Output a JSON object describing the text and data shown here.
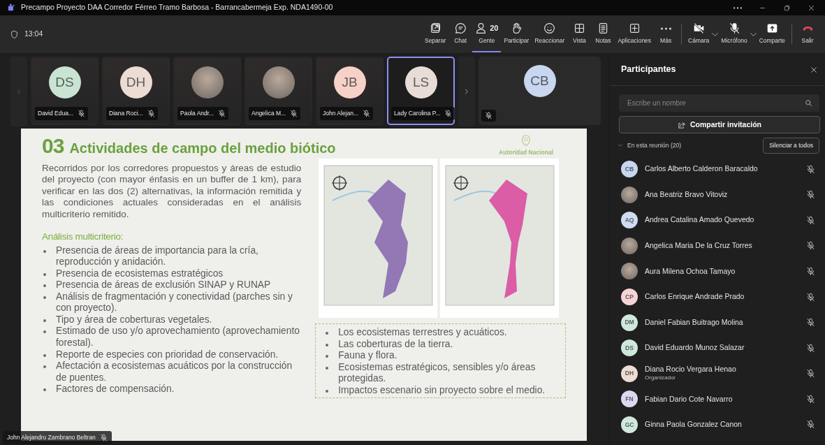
{
  "window": {
    "title": "Precampo Proyecto DAA Corredor Férreo Tramo Barbosa - Barrancabermeja Exp. NDA1490-00"
  },
  "meeting_bar": {
    "timer": "13:04",
    "buttons": [
      {
        "label": "Separar",
        "selected": false
      },
      {
        "label": "Chat",
        "selected": false
      },
      {
        "label": "Gente",
        "count": "20",
        "selected": true
      },
      {
        "label": "Participar",
        "selected": false
      },
      {
        "label": "Reaccionar",
        "selected": false
      },
      {
        "label": "Vista",
        "selected": false
      },
      {
        "label": "Notas",
        "selected": false
      },
      {
        "label": "Aplicaciones",
        "selected": false
      },
      {
        "label": "Más",
        "selected": false
      },
      {
        "label": "Cámara",
        "selected": false,
        "has_menu": true
      },
      {
        "label": "Micrófono",
        "selected": false,
        "has_menu": true
      },
      {
        "label": "Comparte",
        "selected": false
      },
      {
        "label": "Salir",
        "selected": false
      }
    ]
  },
  "video_strip": {
    "tiles": [
      {
        "kind": "initials",
        "initials": "DS",
        "color": "#c9e4d2",
        "name": "David Edua...",
        "selected": false
      },
      {
        "kind": "initials",
        "initials": "DH",
        "color": "#ecdcd4",
        "name": "Diana Roci...",
        "selected": false
      },
      {
        "kind": "photo",
        "name": "Paola Andr...",
        "selected": false
      },
      {
        "kind": "photo",
        "name": "Angelica M...",
        "selected": false
      },
      {
        "kind": "initials",
        "initials": "JB",
        "color": "#f6d1c8",
        "name": "John Alejan...",
        "selected": false
      },
      {
        "kind": "initials",
        "initials": "LS",
        "color": "#e8dcd6",
        "name": "Lady Carolina P...",
        "selected": true
      }
    ],
    "featured": {
      "initials": "CB",
      "color": "#c8d6ef"
    }
  },
  "slide": {
    "number": "03",
    "heading": "Actividades de campo del medio biótico",
    "logo_text": "Autoridad Nacional",
    "intro": "Recorridos por los corredores propuestos y áreas de estudio del proyecto (con mayor énfasis en un buffer de 1 km), para verificar en las dos (2) alternativas, la información remitida y las condiciones actuales consideradas en el análisis multicriterio remitido.",
    "subheading": "Análisis multicriterio:",
    "criteria": [
      "Presencia de áreas de importancia para la cría, reproducción y anidación.",
      "Presencia de ecosistemas estratégicos",
      "Presencia de áreas de exclusión SINAP y RUNAP",
      "Análisis de fragmentación y conectividad (parches sin y con proyecto).",
      "Tipo y área de coberturas vegetales.",
      "Estimado de uso y/o aprovechamiento (aprovechamiento forestal).",
      "Reporte de especies con prioridad de conservación.",
      "Afectación a ecosistemas acuáticos por la construcción de puentes.",
      "Factores de compensación."
    ],
    "box_items": [
      "Los ecosistemas terrestres y acuáticos.",
      "Las coberturas de la tierra.",
      "Fauna y flora.",
      "Ecosistemas estratégicos, sensibles y/o áreas protegidas.",
      "Impactos escenario sin proyecto sobre el medio."
    ]
  },
  "presenter": {
    "name": "John Alejandro Zambrano Beltran"
  },
  "participants_panel": {
    "title": "Participantes",
    "search": {
      "placeholder": "Escribe un nombre"
    },
    "invite_button": "Compartir invitación",
    "section": {
      "label": "En esta reunión (20)",
      "expanded": true
    },
    "mute_all_button": "Silenciar a todos",
    "people": [
      {
        "kind": "initials",
        "initials": "CB",
        "color": "#c8d6ef",
        "name": "Carlos Alberto Calderon Baracaldo"
      },
      {
        "kind": "photo",
        "name": "Ana Beatriz Bravo Vitoviz"
      },
      {
        "kind": "initials",
        "initials": "AQ",
        "color": "#cfdcf2",
        "name": "Andrea Catalina Amado Quevedo"
      },
      {
        "kind": "photo",
        "name": "Angelica Maria De la Cruz Torres"
      },
      {
        "kind": "photo",
        "name": "Aura Milena Ochoa Tamayo"
      },
      {
        "kind": "initials",
        "initials": "CP",
        "color": "#f5d3d6",
        "name": "Carlos Enrique Andrade Prado"
      },
      {
        "kind": "initials",
        "initials": "DM",
        "color": "#cfe8dc",
        "name": "Daniel Fabian Buitrago Molina"
      },
      {
        "kind": "initials",
        "initials": "DS",
        "color": "#cfe8dc",
        "name": "David Eduardo Munoz Salazar"
      },
      {
        "kind": "initials",
        "initials": "DH",
        "color": "#ecdcd4",
        "name": "Diana Rocio Vergara Henao",
        "role": "Organizador"
      },
      {
        "kind": "initials",
        "initials": "FN",
        "color": "#dcd8f2",
        "name": "Fabian Dario Cote Navarro"
      },
      {
        "kind": "initials",
        "initials": "GC",
        "color": "#cfe8dc",
        "name": "Ginna Paola Gonzalez Canon"
      }
    ]
  }
}
